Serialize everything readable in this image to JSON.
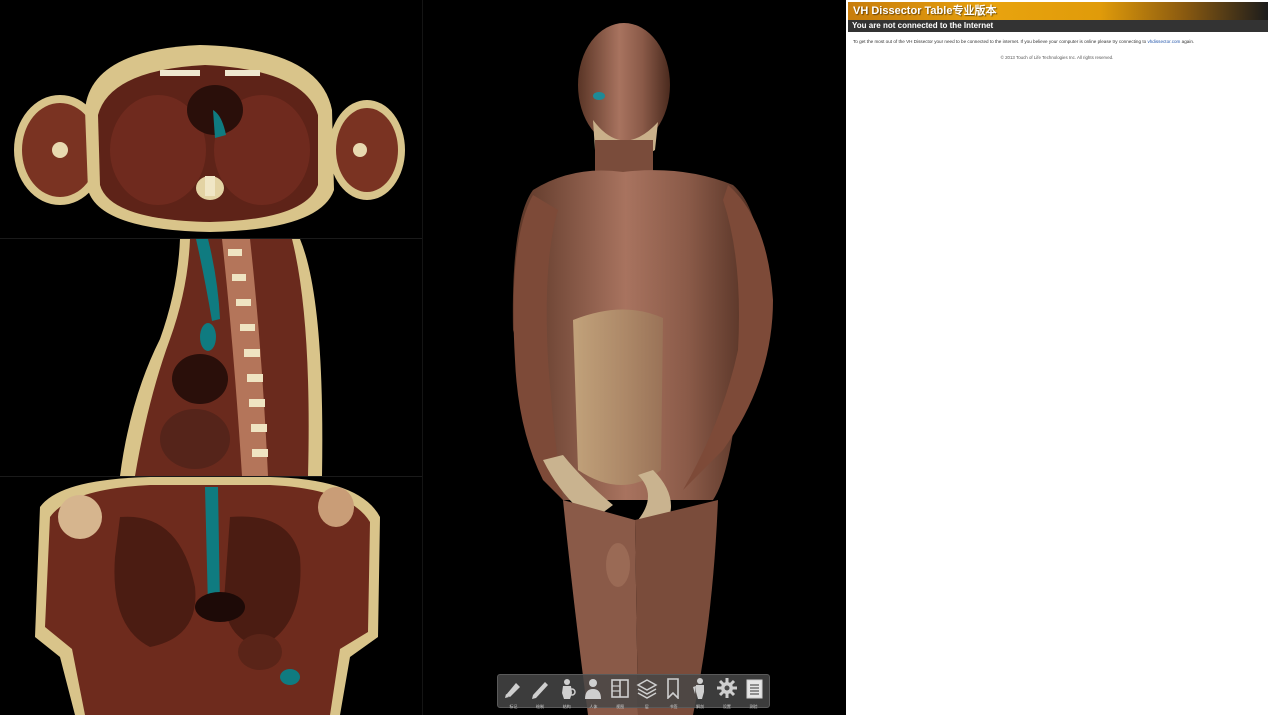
{
  "panel": {
    "title": "VH Dissector Table专业版本",
    "status": "You are not connected to the Internet",
    "message_pre": "To get the most out of the VH Dissector your need to be connected to the internet. If you believe your computer is online please try connecting to",
    "message_link": "vhdissector.com",
    "message_post": "again.",
    "copyright": "© 2013 Touch of Life Technologies Inc. All rights reserved."
  },
  "toolbar": {
    "tools": [
      {
        "icon": "highlighter-icon",
        "label": "标记"
      },
      {
        "icon": "pencil-icon",
        "label": "绘制"
      },
      {
        "icon": "body-search-icon",
        "label": "结构"
      },
      {
        "icon": "person-icon",
        "label": "人体"
      },
      {
        "icon": "panels-icon",
        "label": "视图"
      },
      {
        "icon": "layers-icon",
        "label": "层"
      },
      {
        "icon": "bookmark-icon",
        "label": "书签"
      },
      {
        "icon": "body-layers-icon",
        "label": "解剖"
      },
      {
        "icon": "gear-icon",
        "label": "设置"
      },
      {
        "icon": "notepad-icon",
        "label": "测验"
      }
    ]
  },
  "colors": {
    "tissue_muscle": "#6b2a1c",
    "tissue_fat": "#d9c48a",
    "highlight": "#0f7b80",
    "title_orange": "#e8a30e"
  }
}
